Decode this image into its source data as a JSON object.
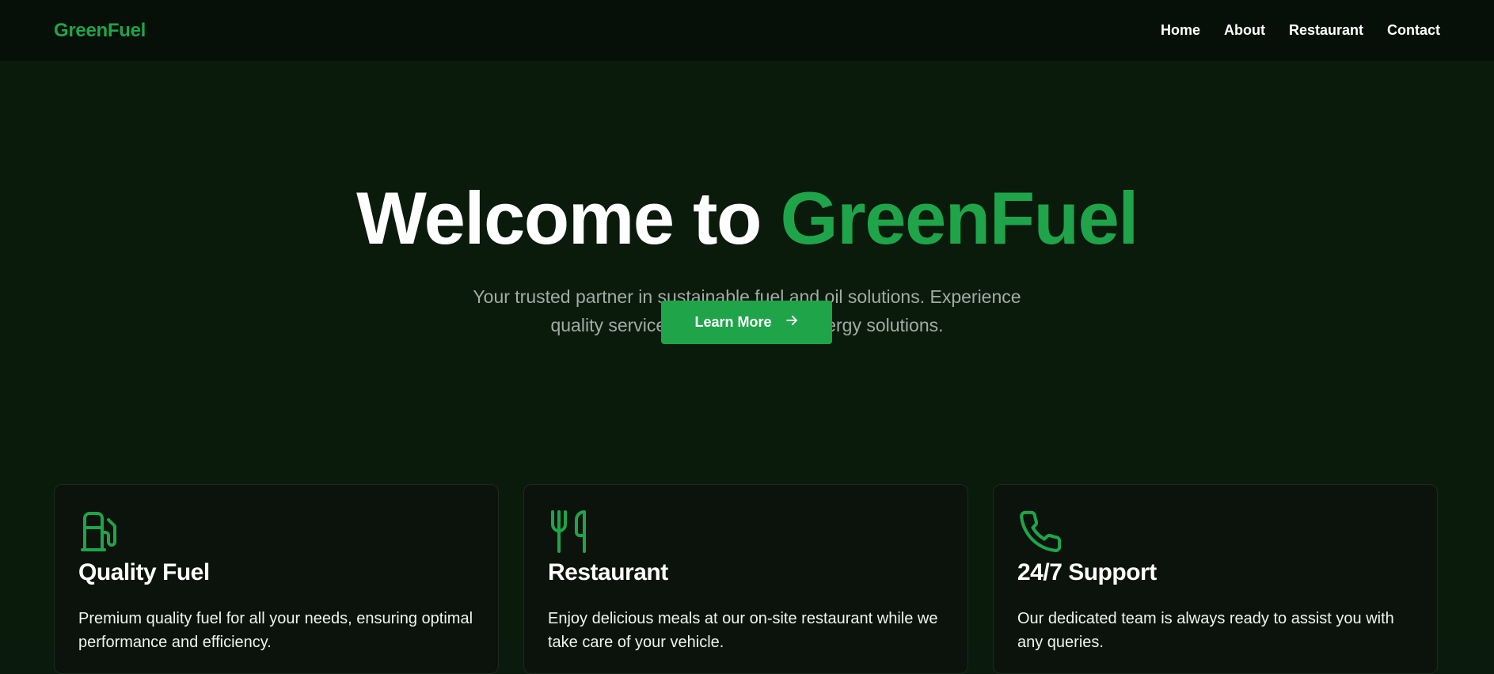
{
  "nav": {
    "brand": "GreenFuel",
    "links": [
      "Home",
      "About",
      "Restaurant",
      "Contact"
    ]
  },
  "hero": {
    "title_prefix": "Welcome to ",
    "title_accent": "GreenFuel",
    "subtitle": "Your trusted partner in sustainable fuel and oil solutions. Experience quality service and eco-friendly energy solutions.",
    "cta_label": "Learn More",
    "cta_icon": "arrow-right-icon"
  },
  "features": [
    {
      "icon": "fuel-pump-icon",
      "title": "Quality Fuel",
      "text": "Premium quality fuel for all your needs, ensuring optimal performance and efficiency."
    },
    {
      "icon": "utensils-icon",
      "title": "Restaurant",
      "text": "Enjoy delicious meals at our on-site restaurant while we take care of your vehicle."
    },
    {
      "icon": "phone-icon",
      "title": "24/7 Support",
      "text": "Our dedicated team is always ready to assist you with any queries."
    }
  ],
  "colors": {
    "accent": "#1fa44a",
    "background": "#0a1b0c",
    "navbar": "#071008",
    "card": "#0c130c"
  }
}
